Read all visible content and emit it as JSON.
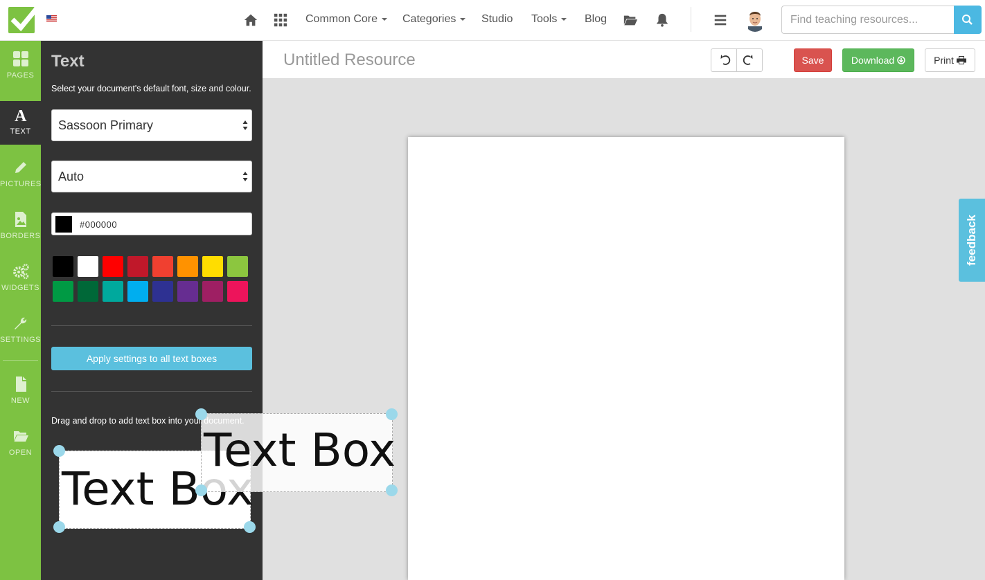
{
  "nav": {
    "links": [
      {
        "label": "Common Core",
        "dropdown": true
      },
      {
        "label": "Categories",
        "dropdown": true
      },
      {
        "label": "Studio",
        "dropdown": false
      },
      {
        "label": "Tools",
        "dropdown": true
      },
      {
        "label": "Blog",
        "dropdown": false
      }
    ],
    "icons": [
      "home-icon",
      "apps-grid-icon",
      "folder-open-icon",
      "bell-icon",
      "menu-icon",
      "search-icon"
    ],
    "search_placeholder": "Find teaching resources..."
  },
  "rail": {
    "items": [
      {
        "label": "PAGES",
        "icon": "pages-icon",
        "active": false
      },
      {
        "label": "TEXT",
        "icon": "text-icon",
        "active": true
      },
      {
        "label": "PICTURES",
        "icon": "pencil-icon",
        "active": false
      },
      {
        "label": "BORDERS",
        "icon": "borders-icon",
        "active": false
      },
      {
        "label": "WIDGETS",
        "icon": "gears-icon",
        "active": false
      },
      {
        "label": "SETTINGS",
        "icon": "wrench-icon",
        "active": false
      },
      {
        "label": "NEW",
        "icon": "new-file-icon",
        "active": false
      },
      {
        "label": "OPEN",
        "icon": "folder-open-icon",
        "active": false
      }
    ]
  },
  "panel": {
    "title": "Text",
    "description": "Select your document's default font, size and colour.",
    "font_value": "Sassoon Primary",
    "size_value": "Auto",
    "color_value": "#000000",
    "swatches": [
      "#000000",
      "#ffffff",
      "#ff0000",
      "#c0182a",
      "#f04030",
      "#ff9200",
      "#ffdd00",
      "#8cc63f",
      "#009a44",
      "#006838",
      "#00a99d",
      "#00aeef",
      "#2e3192",
      "#662d91",
      "#9e1f63",
      "#ed145b"
    ],
    "apply_label": "Apply settings to all text boxes",
    "drag_description": "Drag and drop to add text box into your document.",
    "textbox_label": "Text Box",
    "textbox_drag_label": "Text Box"
  },
  "editor": {
    "title": "Untitled Resource",
    "save_label": "Save",
    "download_label": "Download",
    "print_label": "Print"
  },
  "feedback_label": "feedback",
  "colors": {
    "brand_green": "#7dc242",
    "panel_dark": "#333333",
    "accent_blue": "#5bc0de",
    "save_red": "#d9534f",
    "download_green": "#5cb85c"
  }
}
